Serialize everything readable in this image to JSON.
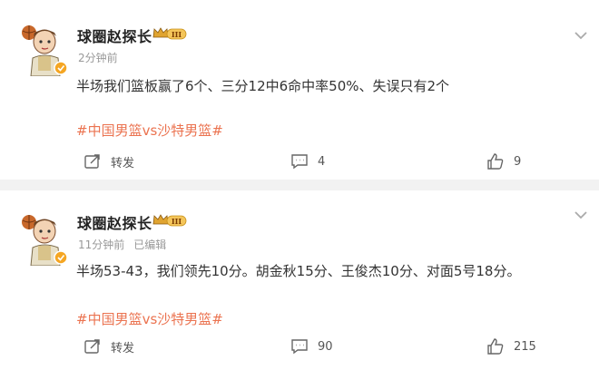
{
  "posts": [
    {
      "username": "球圈赵探长",
      "vip_level": "III",
      "time": "2分钟前",
      "edited": "",
      "content": "半场我们篮板赢了6个、三分12中6命中率50%、失误只有2个",
      "hashtag": "#中国男篮vs沙特男篮#",
      "repost_label": "转发",
      "comment_count": "4",
      "like_count": "9"
    },
    {
      "username": "球圈赵探长",
      "vip_level": "III",
      "time": "11分钟前",
      "edited": "已编辑",
      "content": "半场53-43，我们领先10分。胡金秋15分、王俊杰10分、对面5号18分。",
      "hashtag": "#中国男篮vs沙特男篮#",
      "repost_label": "转发",
      "comment_count": "90",
      "like_count": "215"
    }
  ],
  "colors": {
    "hashtag": "#eb7350",
    "vip_gold": "#e0a431",
    "verified": "#f5a623",
    "meta": "#999999"
  },
  "icons": {
    "avatar": "cartoon-avatar-basketball",
    "verified": "verified-badge-icon",
    "vip": "vip-crown-badge-icon",
    "repost": "repost-icon",
    "comment": "comment-icon",
    "like": "like-thumb-icon",
    "more": "chevron-down-icon"
  }
}
